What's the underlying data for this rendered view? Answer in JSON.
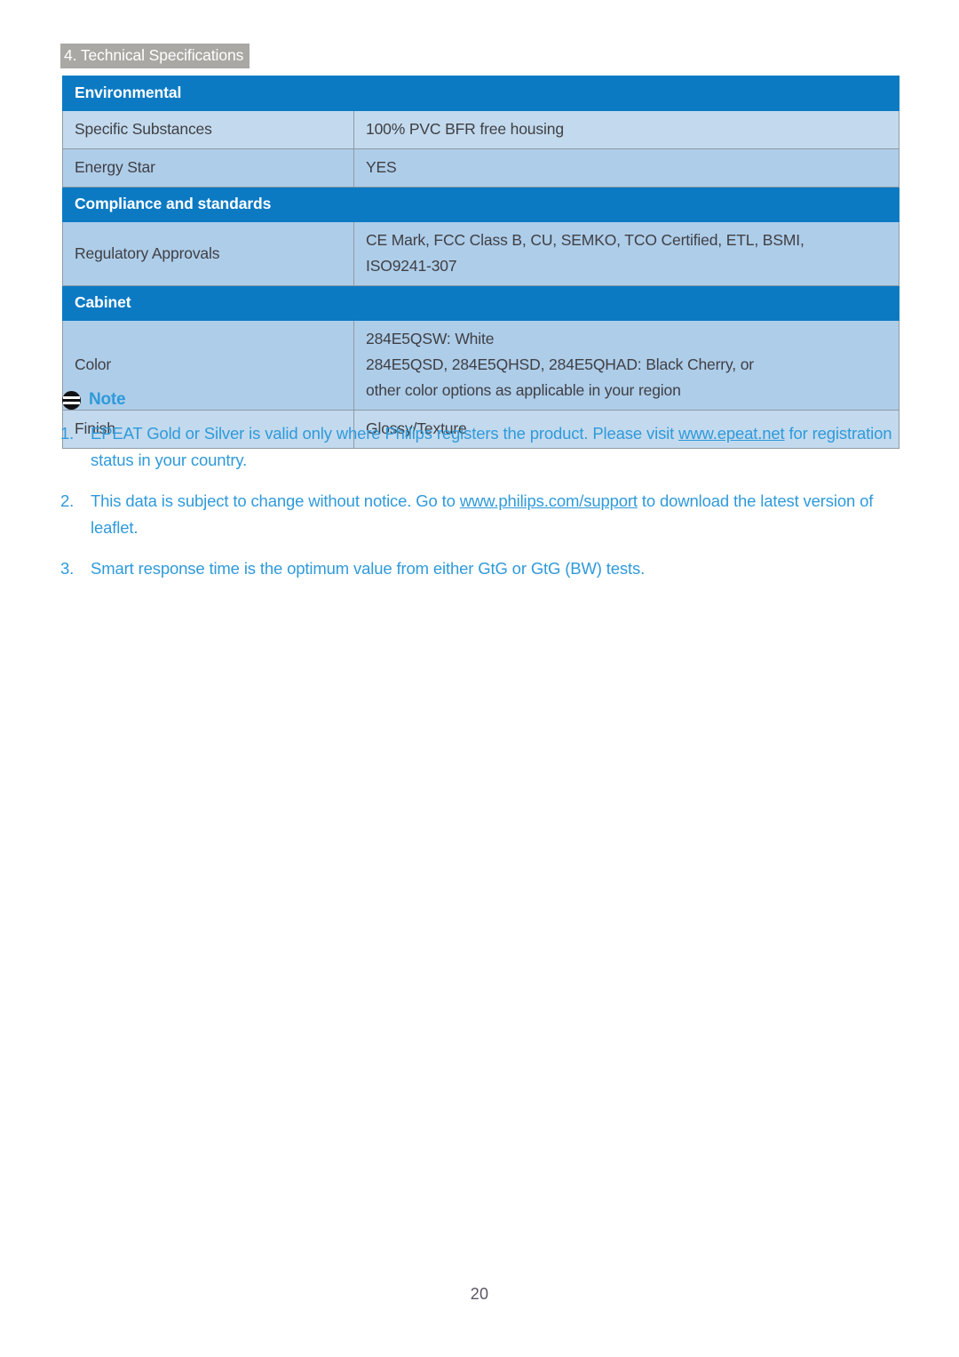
{
  "breadcrumb": {
    "label": "4. Technical Specifications"
  },
  "spec_table": {
    "rows": [
      {
        "kind": "section",
        "label": "Environmental"
      },
      {
        "kind": "data",
        "band": "a",
        "label": "Specific Substances",
        "value_lines": [
          "100% PVC BFR free housing"
        ]
      },
      {
        "kind": "data",
        "band": "b",
        "label": "Energy Star",
        "value_lines": [
          "YES"
        ]
      },
      {
        "kind": "section",
        "label": "Compliance and standards"
      },
      {
        "kind": "data",
        "band": "b",
        "label": "Regulatory Approvals",
        "value_lines": [
          "CE Mark, FCC Class B, CU, SEMKO, TCO Certified, ETL,  BSMI,",
          "ISO9241-307"
        ]
      },
      {
        "kind": "section",
        "label": "Cabinet"
      },
      {
        "kind": "data",
        "band": "b",
        "label": "Color",
        "value_lines": [
          "284E5QSW: White",
          "284E5QSD, 284E5QHSD, 284E5QHAD: Black Cherry, or",
          "other color options as applicable in your region"
        ]
      },
      {
        "kind": "data",
        "band": "a",
        "label": "Finish",
        "value_lines": [
          "Glossy/Texture"
        ]
      }
    ]
  },
  "note": {
    "title": "Note",
    "icon": "note-icon",
    "items": [
      {
        "number": "1.",
        "text_before": "EPEAT Gold or Silver is valid only where Philips registers the product. Please visit ",
        "link": "www.epeat.net",
        "text_after": " for registration status in your country."
      },
      {
        "number": "2.",
        "text_before": "This data is subject to change without notice. Go to ",
        "link": "www.philips.com/support",
        "text_after": " to download the latest version of leaflet."
      },
      {
        "number": "3.",
        "text_before": "Smart response time is the optimum value from either GtG or GtG (BW) tests.",
        "link": "",
        "text_after": ""
      }
    ]
  },
  "footer": {
    "page_number": "20"
  },
  "colors": {
    "section_blue": "#0b7ac3",
    "band_a": "#c3daee",
    "band_b": "#aecde9",
    "breadcrumb_gray": "#a9a8a4",
    "note_blue": "#2f9ada",
    "table_border": "#8f9aa4"
  }
}
